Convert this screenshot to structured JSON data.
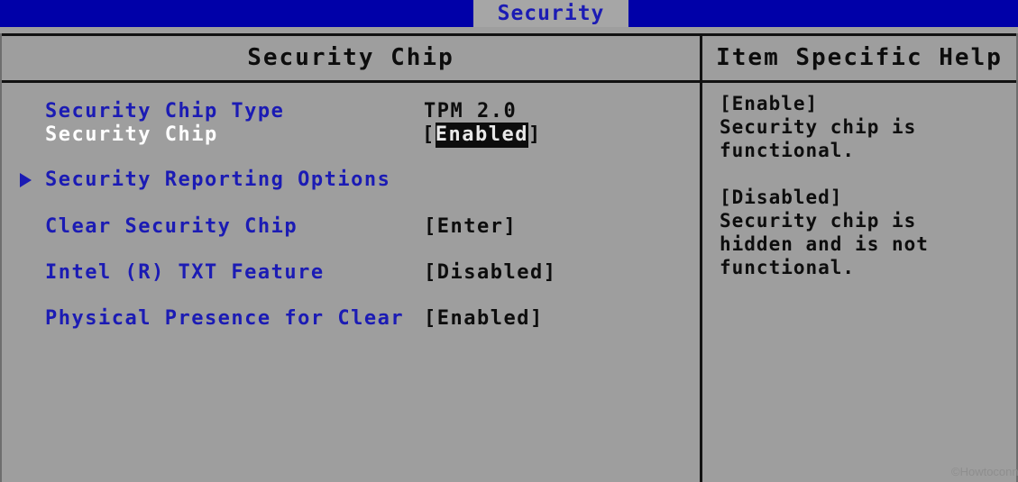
{
  "tabbar": {
    "active_tab": "Security",
    "background_color": "#0000a8",
    "tab_background_color": "#a6a6a6",
    "tab_text_color": "#1b1bb4"
  },
  "panels": {
    "left_header": "Security Chip",
    "right_header": "Item Specific Help"
  },
  "settings": {
    "rows": [
      {
        "label": "Security Chip Type",
        "value": "TPM 2.0",
        "selected": false,
        "submenu": false,
        "highlighted": false
      },
      {
        "label": "Security Chip",
        "value": "[Enabled]",
        "value_bracket_open": "[",
        "value_inner": "Enabled",
        "value_bracket_close": "]",
        "selected": true,
        "submenu": false,
        "highlighted": true
      },
      {
        "label": "Security Reporting Options",
        "value": "",
        "selected": false,
        "submenu": true,
        "highlighted": false
      },
      {
        "label": "Clear Security Chip",
        "value": "[Enter]",
        "selected": false,
        "submenu": false,
        "highlighted": false
      },
      {
        "label": "Intel (R) TXT Feature",
        "value": "[Disabled]",
        "selected": false,
        "submenu": false,
        "highlighted": false
      },
      {
        "label": "Physical Presence for Clear",
        "value": "[Enabled]",
        "selected": false,
        "submenu": false,
        "highlighted": false
      }
    ]
  },
  "help": {
    "paragraphs": [
      {
        "heading": "[Enable]",
        "lines": [
          "Security chip is",
          "functional."
        ]
      },
      {
        "heading": "[Disabled]",
        "lines": [
          "Security chip is",
          "hidden and is not",
          "functional."
        ]
      }
    ]
  },
  "watermark": {
    "text": "©Howtoconnec"
  },
  "colors": {
    "background": "#9e9e9e",
    "label_blue": "#1b1bb4",
    "selected_white": "#ffffff",
    "value_black": "#0d0d0d",
    "tab_blue": "#0000a8"
  }
}
